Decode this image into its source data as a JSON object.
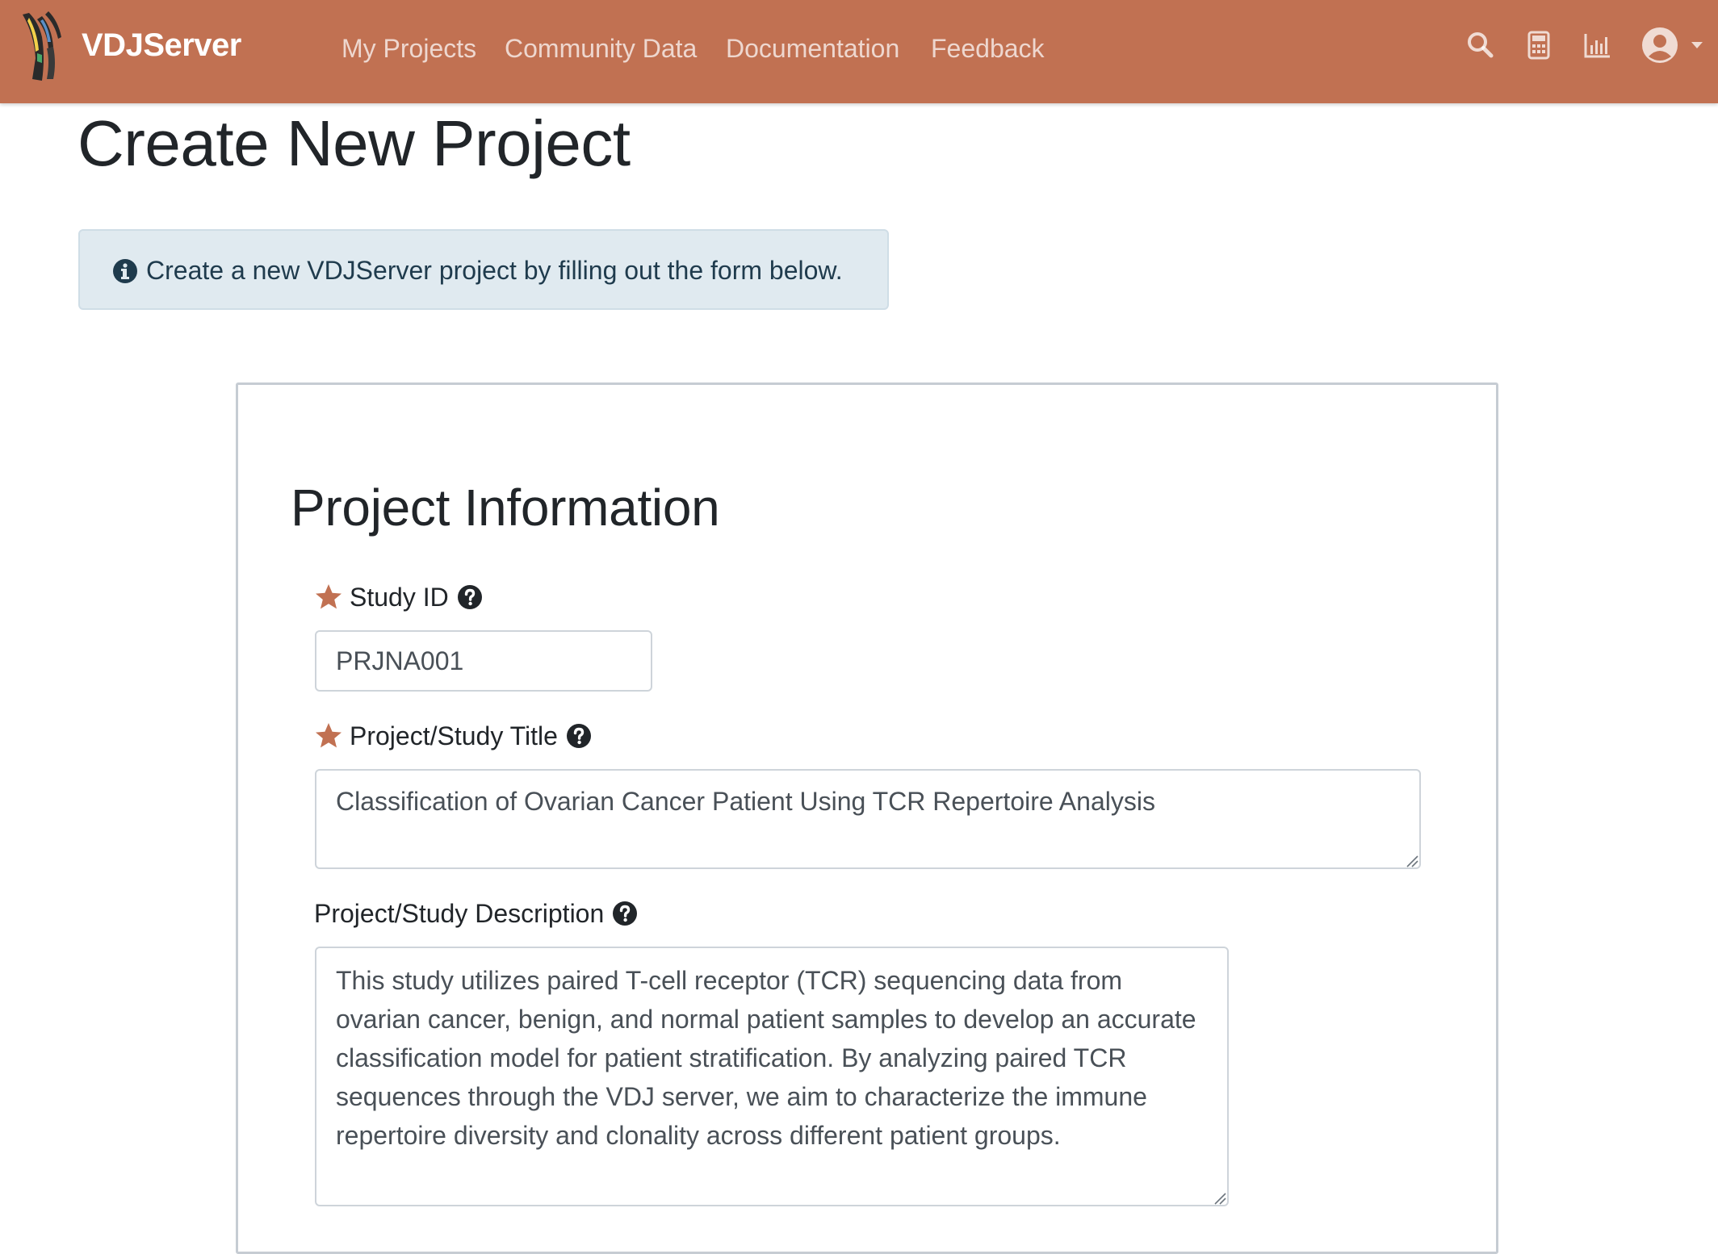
{
  "app": {
    "brand_name": "VDJServer",
    "accent_color": "#c17152",
    "logo_icon": "vdjserver-logo-icon"
  },
  "nav": {
    "links": [
      {
        "label": "My Projects"
      },
      {
        "label": "Community Data"
      },
      {
        "label": "Documentation"
      },
      {
        "label": "Feedback"
      }
    ],
    "icons": [
      "search-icon",
      "calculator-icon",
      "chart-icon",
      "user-circle-icon",
      "caret-down-icon"
    ]
  },
  "page": {
    "title": "Create New Project",
    "info_message": "Create a new VDJServer project by filling out the form below.",
    "info_icon": "info-circle-icon"
  },
  "form": {
    "section_heading": "Project Information",
    "fields": {
      "study_id": {
        "label": "Study ID",
        "required": true,
        "value": "PRJNA001"
      },
      "title": {
        "label": "Project/Study Title",
        "required": true,
        "value": "Classification of Ovarian Cancer Patient Using TCR Repertoire Analysis"
      },
      "description": {
        "label": "Project/Study Description",
        "required": false,
        "value": "This study utilizes paired T-cell receptor (TCR) sequencing data from ovarian cancer, benign, and normal patient samples to develop an accurate classification model for patient stratification. By analyzing paired TCR sequences through the VDJ server, we aim to characterize the immune repertoire diversity and clonality across different patient groups."
      }
    }
  }
}
